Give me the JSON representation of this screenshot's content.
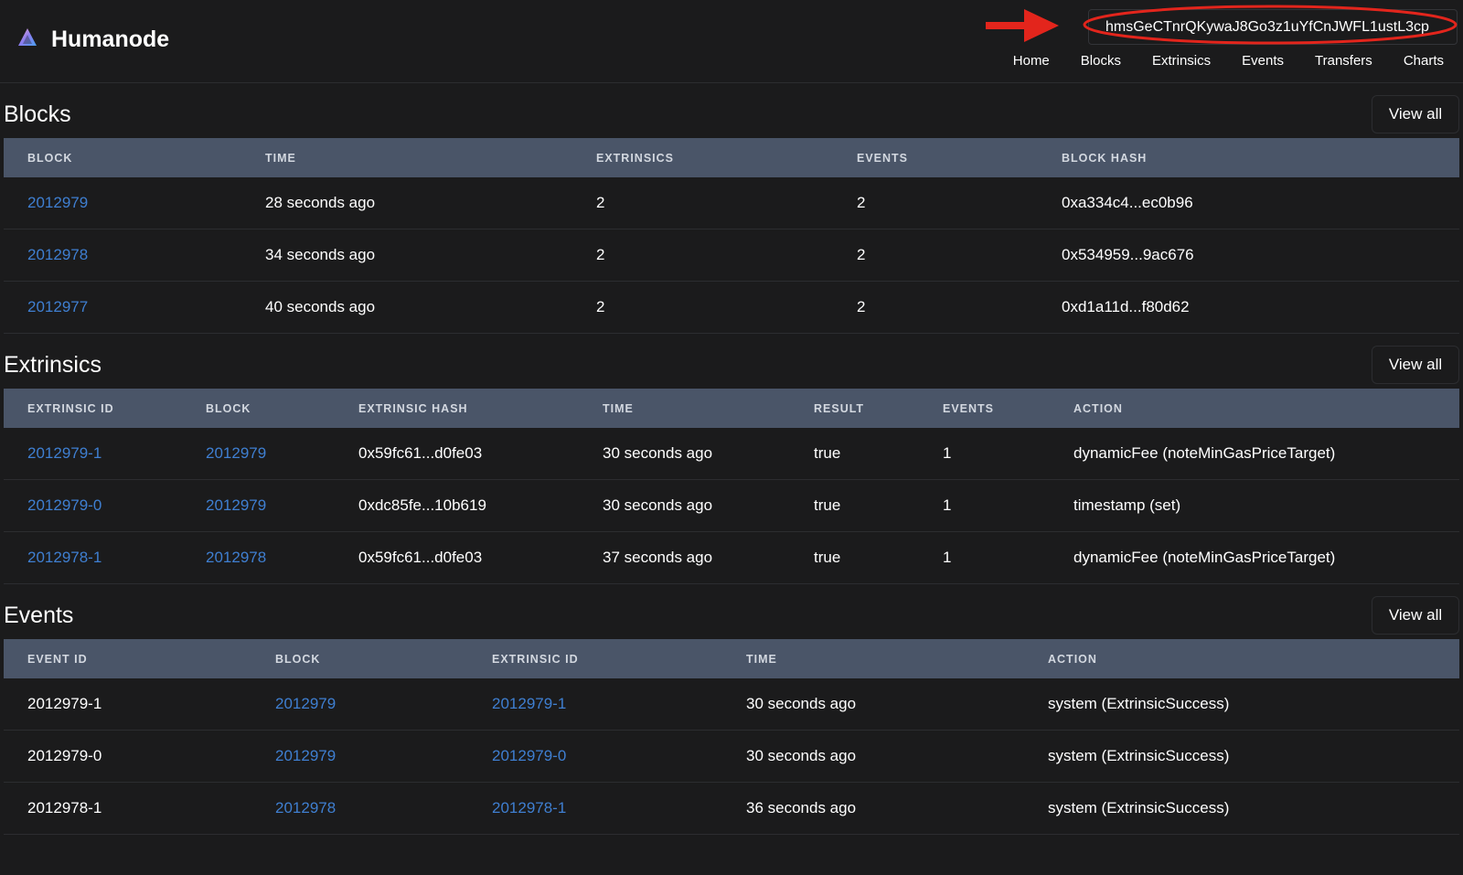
{
  "brand": {
    "name": "Humanode",
    "icon": "humanode-logo-icon"
  },
  "search": {
    "value": "hmsGeCTnrQKywaJ8Go3z1uYfCnJWFL1ustL3cp"
  },
  "annotation": {
    "color": "#e3251c"
  },
  "nav": [
    "Home",
    "Blocks",
    "Extrinsics",
    "Events",
    "Transfers",
    "Charts"
  ],
  "colors": {
    "background": "#1b1b1c",
    "table_header": "#4a5568",
    "link": "#3f7fd1"
  },
  "blocks": {
    "title": "Blocks",
    "view_all": "View all",
    "columns": [
      "BLOCK",
      "TIME",
      "EXTRINSICS",
      "EVENTS",
      "BLOCK HASH"
    ],
    "rows": [
      [
        "2012979",
        "28 seconds ago",
        "2",
        "2",
        "0xa334c4...ec0b96"
      ],
      [
        "2012978",
        "34 seconds ago",
        "2",
        "2",
        "0x534959...9ac676"
      ],
      [
        "2012977",
        "40 seconds ago",
        "2",
        "2",
        "0xd1a11d...f80d62"
      ]
    ]
  },
  "extrinsics": {
    "title": "Extrinsics",
    "view_all": "View all",
    "columns": [
      "EXTRINSIC ID",
      "BLOCK",
      "EXTRINSIC HASH",
      "TIME",
      "RESULT",
      "EVENTS",
      "ACTION"
    ],
    "rows": [
      [
        "2012979-1",
        "2012979",
        "0x59fc61...d0fe03",
        "30 seconds ago",
        "true",
        "1",
        "dynamicFee (noteMinGasPriceTarget)"
      ],
      [
        "2012979-0",
        "2012979",
        "0xdc85fe...10b619",
        "30 seconds ago",
        "true",
        "1",
        "timestamp (set)"
      ],
      [
        "2012978-1",
        "2012978",
        "0x59fc61...d0fe03",
        "37 seconds ago",
        "true",
        "1",
        "dynamicFee (noteMinGasPriceTarget)"
      ]
    ]
  },
  "events": {
    "title": "Events",
    "view_all": "View all",
    "columns": [
      "EVENT ID",
      "BLOCK",
      "EXTRINSIC ID",
      "TIME",
      "ACTION"
    ],
    "rows": [
      [
        "2012979-1",
        "2012979",
        "2012979-1",
        "30 seconds ago",
        "system (ExtrinsicSuccess)"
      ],
      [
        "2012979-0",
        "2012979",
        "2012979-0",
        "30 seconds ago",
        "system (ExtrinsicSuccess)"
      ],
      [
        "2012978-1",
        "2012978",
        "2012978-1",
        "36 seconds ago",
        "system (ExtrinsicSuccess)"
      ]
    ]
  }
}
